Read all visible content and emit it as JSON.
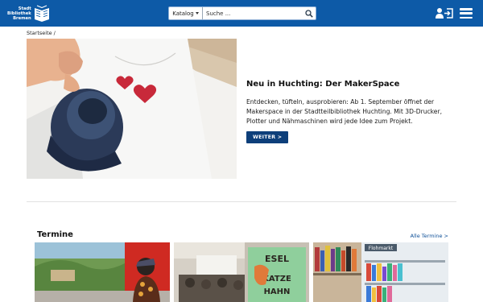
{
  "header": {
    "logo_lines": [
      "Stadt",
      "Bibliothek",
      "Bremen"
    ],
    "search_scope": "Katalog",
    "search_placeholder": "Suche ..."
  },
  "breadcrumb": "Startseite /",
  "hero": {
    "title": "Neu in Huchting: Der MakerSpace",
    "description": "Entdecken, tüfteln, ausprobieren: Ab 1. September öffnet der Makerspace in der Stadtteilbibliothek Huchting. Mit 3D-Drucker, Plotter und Nähmaschinen wird jede Idee zum Projekt.",
    "button_label": "WEITER >"
  },
  "termine": {
    "title": "Termine",
    "all_link": "Alle Termine >",
    "cards": [
      {
        "image": "event-garden-screen"
      },
      {
        "image": "event-audience-presentation",
        "book_text": [
          "ESEL",
          "KATZE",
          "HAHN"
        ]
      },
      {
        "image": "event-bookshelves",
        "shelf_label": "Flohmarkt"
      }
    ]
  },
  "colors": {
    "header_bg": "#0d5aa7",
    "button_bg": "#0d3f7a",
    "link": "#0d4f97"
  }
}
